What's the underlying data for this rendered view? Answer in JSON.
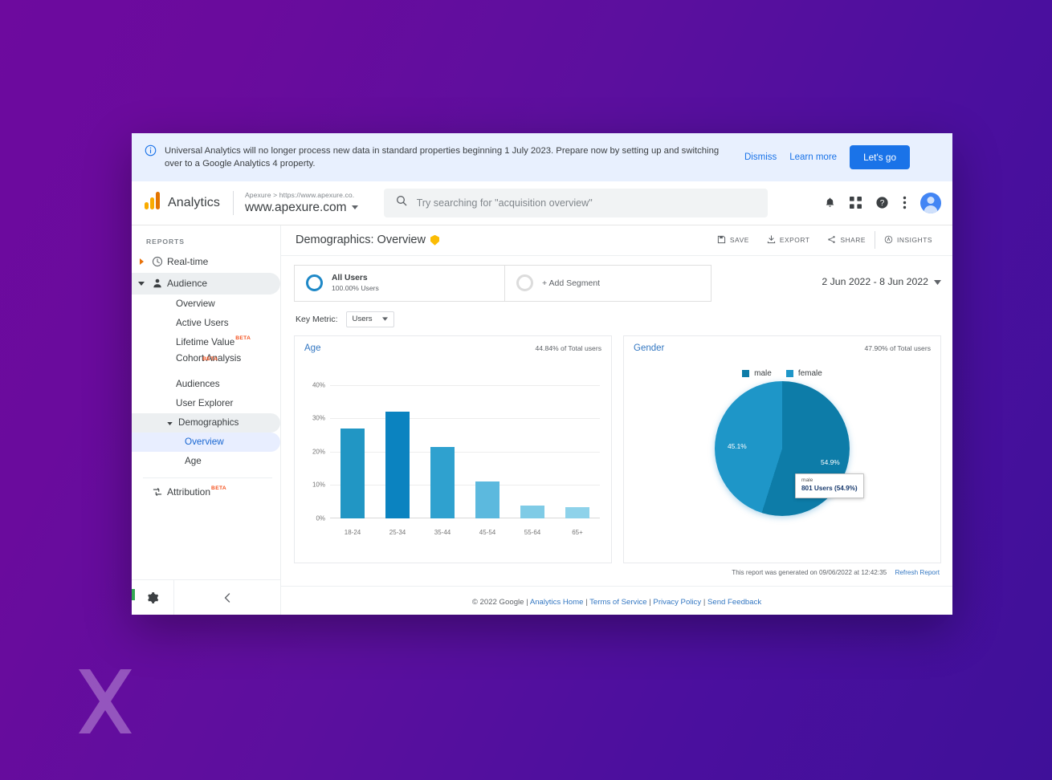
{
  "notice": {
    "icon": "info-icon",
    "text": "Universal Analytics will no longer process new data in standard properties beginning 1 July 2023. Prepare now by setting up and switching over to a Google Analytics 4 property.",
    "dismiss_label": "Dismiss",
    "learn_more_label": "Learn more",
    "cta_label": "Let's go"
  },
  "topbar": {
    "brand": "Analytics",
    "property_breadcrumb": "Apexure > https://www.apexure.co.",
    "property_name": "www.apexure.com",
    "search_placeholder": "Try searching for \"acquisition overview\"",
    "search_value": ""
  },
  "sidebar": {
    "section_label": "REPORTS",
    "realtime": "Real-time",
    "audience": "Audience",
    "items": [
      {
        "label": "Overview"
      },
      {
        "label": "Active Users"
      },
      {
        "label": "Lifetime Value",
        "badge": "BETA"
      },
      {
        "label": "Cohort Analysis",
        "badge": "BETA"
      },
      {
        "label": "Audiences"
      },
      {
        "label": "User Explorer"
      }
    ],
    "demographics": "Demographics",
    "demographics_children": [
      {
        "label": "Overview",
        "selected": true
      },
      {
        "label": "Age",
        "selected": false
      }
    ],
    "attribution": "Attribution",
    "attribution_badge": "BETA"
  },
  "page": {
    "title": "Demographics: Overview",
    "tools": [
      {
        "label": "SAVE",
        "icon": "save-icon"
      },
      {
        "label": "EXPORT",
        "icon": "export-icon"
      },
      {
        "label": "SHARE",
        "icon": "share-icon"
      },
      {
        "label": "INSIGHTS",
        "icon": "insights-icon"
      }
    ],
    "segment_all_title": "All Users",
    "segment_all_sub": "100.00% Users",
    "segment_add_label": "+ Add Segment",
    "date_range": "2 Jun 2022 - 8 Jun 2022",
    "key_metric_label": "Key Metric:",
    "key_metric_value": "Users",
    "report_generated": "This report was generated on 09/06/2022 at 12:42:35",
    "refresh_label": "Refresh Report"
  },
  "footer": {
    "copyright": "© 2022 Google",
    "links": [
      "Analytics Home",
      "Terms of Service",
      "Privacy Policy",
      "Send Feedback"
    ],
    "sep": "|"
  },
  "chart_data": [
    {
      "type": "bar",
      "title": "Age",
      "subtitle": "44.84% of Total users",
      "categories": [
        "18-24",
        "25-34",
        "35-44",
        "45-54",
        "55-64",
        "65+"
      ],
      "values": [
        27.0,
        32.0,
        21.3,
        11.1,
        3.7,
        3.2
      ],
      "colors": [
        "#2196c4",
        "#0b83c0",
        "#2fa1cf",
        "#5cb9de",
        "#7fcbe6",
        "#8ed2ea"
      ],
      "xlabel": "",
      "ylabel": "",
      "ylim": [
        0,
        40
      ],
      "yticks": [
        "0%",
        "10%",
        "20%",
        "30%",
        "40%"
      ],
      "grid": true,
      "legend": "none"
    },
    {
      "type": "pie",
      "title": "Gender",
      "subtitle": "47.90% of Total users",
      "labels": [
        "male",
        "female"
      ],
      "values": [
        54.9,
        45.1
      ],
      "value_labels": [
        "54.9%",
        "45.1%"
      ],
      "colors": [
        "#0d7ca8",
        "#1e96c8"
      ],
      "legend": "top",
      "tooltip": {
        "title": "male",
        "value": "801 Users (54.9%)"
      }
    }
  ],
  "theme": {
    "accent_blue": "#1a73e8",
    "link_blue": "#3377c2",
    "notice_bg": "#e8f0fe",
    "bar_dark": "#0b83c0",
    "bg_purple_left": "#6d0a9e",
    "bg_purple_right": "#3f1099"
  }
}
